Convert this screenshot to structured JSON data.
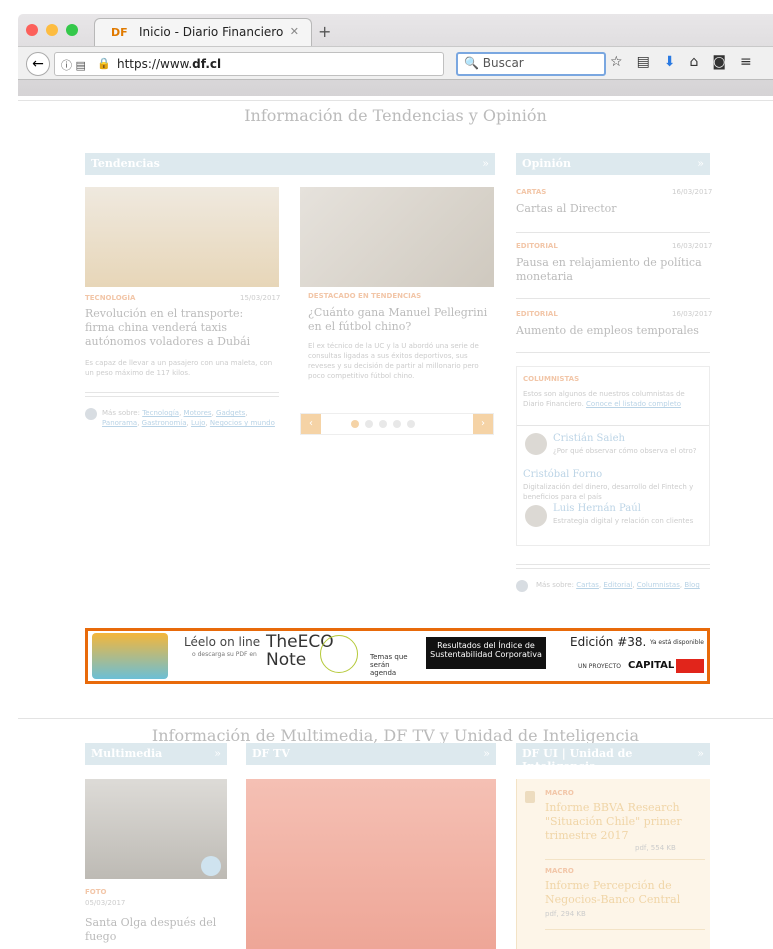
{
  "browser": {
    "tab_logo": "DF",
    "tab_title": "Inicio - Diario Financiero",
    "tab_close": "✕",
    "new_tab": "+",
    "url_prefix": "https://www.",
    "url_domain": "df.cl",
    "search_placeholder": "Buscar"
  },
  "sections": {
    "top_title": "Información de Tendencias y Opinión",
    "bottom_title": "Información de Multimedia, DF TV y Unidad de Inteligencia"
  },
  "tendencias": {
    "header": "Tendencias",
    "arrow": "»",
    "article1": {
      "category": "TECNOLOGÍA",
      "date": "15/03/2017",
      "title": "Revolución en el transporte: firma china venderá taxis autónomos voladores a Dubái",
      "summary": "Es capaz de llevar a un pasajero con una maleta, con un peso máximo de 117 kilos."
    },
    "article2": {
      "category": "DESTACADO EN TENDENCIAS",
      "title": "¿Cuánto gana Manuel Pellegrini en el fútbol chino?",
      "summary": "El ex técnico de la UC y la U abordó una serie de consultas ligadas a sus éxitos deportivos, sus reveses y su decisión de partir al millonario pero poco competitivo fútbol chino."
    },
    "more_label": "Más sobre:",
    "more_links": [
      "Tecnología",
      "Motores",
      "Gadgets",
      "Panorama",
      "Gastronomía",
      "Lujo",
      "Negocios y mundo"
    ],
    "pager_prev": "‹",
    "pager_next": "›"
  },
  "opinion": {
    "header": "Opinión",
    "arrow": "»",
    "items": [
      {
        "category": "CARTAS",
        "date": "16/03/2017",
        "title": "Cartas al Director"
      },
      {
        "category": "EDITORIAL",
        "date": "16/03/2017",
        "title": "Pausa en relajamiento de política monetaria"
      },
      {
        "category": "EDITORIAL",
        "date": "16/03/2017",
        "title": "Aumento de empleos temporales"
      }
    ],
    "columnistas": {
      "label": "COLUMNISTAS",
      "intro": "Estos son algunos de nuestros columnistas de Diario Financiero.",
      "link": "Conoce el listado completo",
      "people": [
        {
          "name": "Cristián Saieh",
          "topic": "¿Por qué observar cómo observa el otro?"
        },
        {
          "name": "Cristóbal Forno",
          "topic": "Digitalización del dinero, desarrollo del Fintech y beneficios para el país"
        },
        {
          "name": "Luis Hernán Paúl",
          "topic": "Estrategia digital y relación con clientes"
        }
      ]
    },
    "more_label": "Más sobre:",
    "more_links": [
      "Cartas",
      "Editorial",
      "Columnistas",
      "Blog"
    ]
  },
  "ad": {
    "read": "Léelo on line",
    "download": "o descarga su PDF en",
    "brand": "TheECO Note",
    "topics": "Temas que serán agenda",
    "result": "Resultados del Índice de Sustentabilidad Corporativa",
    "edition": "Edición #38.",
    "available": "Ya está disponible",
    "project": "UN PROYECTO",
    "capital": "CAPITAL"
  },
  "multimedia": {
    "header": "Multimedia",
    "arrow": "»",
    "category": "FOTO",
    "date": "05/03/2017",
    "title": "Santa Olga después del fuego"
  },
  "dftv": {
    "header": "DF TV",
    "arrow": "»"
  },
  "dfui": {
    "header": "DF UI | Unidad de Inteligencia",
    "arrow": "»",
    "items": [
      {
        "category": "MACRO",
        "title": "Informe BBVA Research \"Situación Chile\" primer trimestre 2017",
        "meta": "pdf, 554 KB"
      },
      {
        "category": "MACRO",
        "title": "Informe Percepción de Negocios-Banco Central",
        "meta": "pdf, 294 KB"
      }
    ]
  }
}
